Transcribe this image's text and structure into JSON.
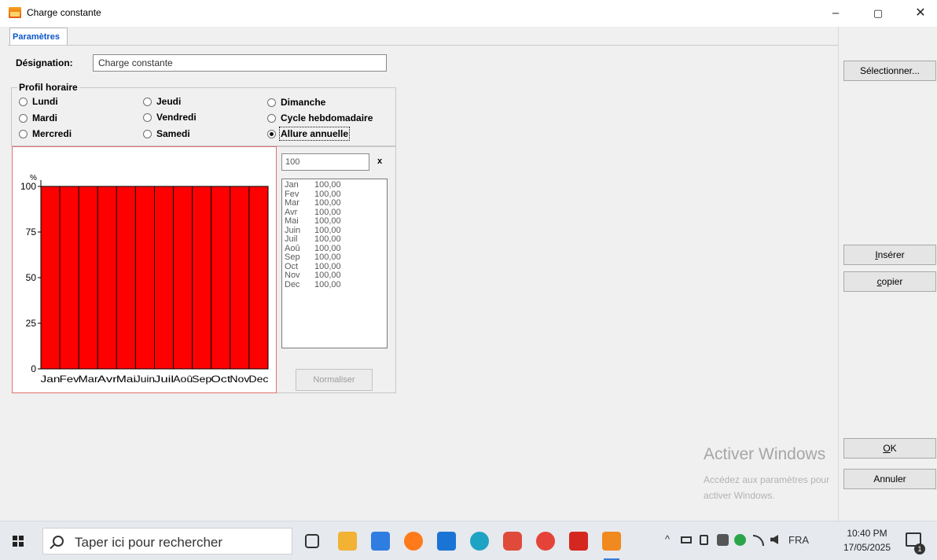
{
  "window": {
    "title": "Charge constante",
    "minimize_glyph": "–",
    "maximize_glyph": "▢",
    "close_glyph": "✕"
  },
  "tabs": [
    {
      "label": "Paramètres",
      "active": true
    }
  ],
  "designation": {
    "label": "Désignation:",
    "value": "Charge constante"
  },
  "profile": {
    "title": "Profil horaire",
    "options": [
      {
        "label": "Lundi",
        "checked": false
      },
      {
        "label": "Mardi",
        "checked": false
      },
      {
        "label": "Mercredi",
        "checked": false
      },
      {
        "label": "Jeudi",
        "checked": false
      },
      {
        "label": "Vendredi",
        "checked": false
      },
      {
        "label": "Samedi",
        "checked": false
      },
      {
        "label": "Dimanche",
        "checked": false
      },
      {
        "label": "Cycle hebdomadaire",
        "checked": false
      },
      {
        "label": "Allure annuelle",
        "checked": true
      }
    ]
  },
  "factor": {
    "value": "100",
    "clear_label": "x"
  },
  "monthly_list": [
    {
      "month": "Jan",
      "value": "100,00"
    },
    {
      "month": "Fev",
      "value": "100,00"
    },
    {
      "month": "Mar",
      "value": "100,00"
    },
    {
      "month": "Avr",
      "value": "100,00"
    },
    {
      "month": "Mai",
      "value": "100,00"
    },
    {
      "month": "Juin",
      "value": "100,00"
    },
    {
      "month": "Juil",
      "value": "100,00"
    },
    {
      "month": "Aoû",
      "value": "100,00"
    },
    {
      "month": "Sep",
      "value": "100,00"
    },
    {
      "month": "Oct",
      "value": "100,00"
    },
    {
      "month": "Nov",
      "value": "100,00"
    },
    {
      "month": "Dec",
      "value": "100,00"
    }
  ],
  "normalize_button": {
    "label": "Normaliser",
    "disabled": true
  },
  "right_buttons": {
    "select": "Sélectionner...",
    "insert_u": "I",
    "insert_rest": "nsérer",
    "copy_u": "c",
    "copy_rest": "opier",
    "ok_u": "O",
    "ok_rest": "K",
    "cancel": "Annuler"
  },
  "watermark": {
    "title": "Activer Windows",
    "subtitle": "Accédez aux paramètres pour activer Windows."
  },
  "taskbar": {
    "search_placeholder": "Taper ici pour rechercher",
    "language": "FRA",
    "time": "10:40 PM",
    "date": "17/05/2025",
    "notification_count": "1",
    "tray_chevron": "^"
  },
  "colors": {
    "bar": "#ff0000",
    "accent": "#0b57c8",
    "chart_border": "#e07070"
  },
  "chart_data": {
    "type": "bar",
    "categories": [
      "Jan",
      "Fev",
      "Mar",
      "Avr",
      "Mai",
      "Juin",
      "Juil",
      "Aoû",
      "Sep",
      "Oct",
      "Nov",
      "Dec"
    ],
    "values": [
      100,
      100,
      100,
      100,
      100,
      100,
      100,
      100,
      100,
      100,
      100,
      100
    ],
    "ylabel": "%",
    "ylim": [
      0,
      100
    ],
    "yticks": [
      0,
      25,
      50,
      75,
      100
    ],
    "grid": false,
    "bar_color": "#ff0000"
  }
}
